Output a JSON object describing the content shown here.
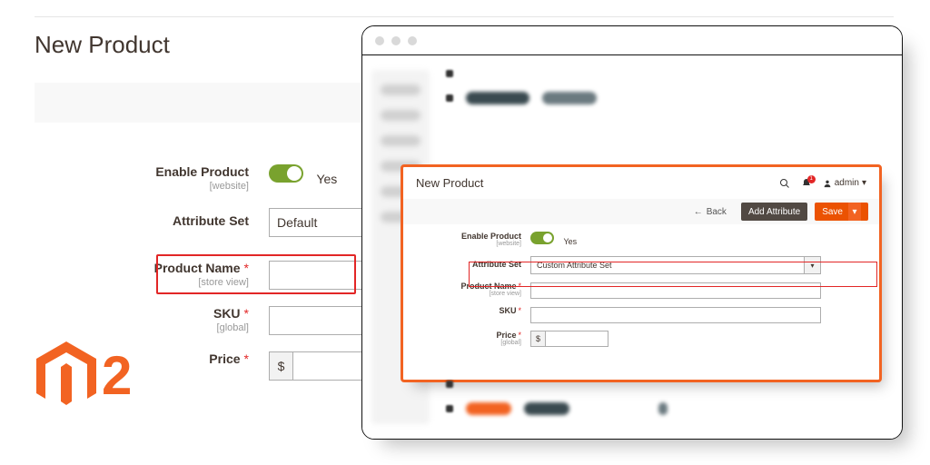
{
  "bg": {
    "title": "New Product",
    "enable_label": "Enable Product",
    "enable_scope": "[website]",
    "enable_value": "Yes",
    "attrset_label": "Attribute Set",
    "attrset_value": "Default",
    "pname_label": "Product Name",
    "pname_scope": "[store view]",
    "sku_label": "SKU",
    "sku_scope": "[global]",
    "price_label": "Price",
    "price_prefix": "$"
  },
  "logo": {
    "two": "2"
  },
  "popup": {
    "title": "New Product",
    "admin_label": "admin",
    "notif_count": "1",
    "back_label": "Back",
    "addattr_label": "Add Attribute",
    "save_label": "Save",
    "enable_label": "Enable Product",
    "enable_scope": "[website]",
    "enable_value": "Yes",
    "attrset_label": "Attribute Set",
    "attrset_value": "Custom Attribute Set",
    "pname_label": "Product Name",
    "pname_scope": "[store view]",
    "sku_label": "SKU",
    "price_label": "Price",
    "price_scope": "[global]",
    "price_prefix": "$"
  }
}
